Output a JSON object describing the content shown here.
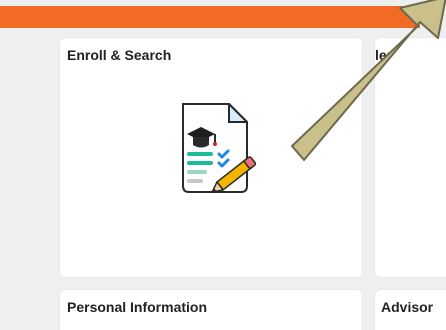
{
  "header": {
    "accent_color": "#f26a23"
  },
  "tiles": {
    "enroll": {
      "title": "Enroll & Search",
      "icon": "enroll-document-icon"
    },
    "partial_top": {
      "title": "ler"
    },
    "personal": {
      "title": "Personal Information"
    },
    "advisor": {
      "title": "Advisor"
    }
  },
  "annotation": {
    "arrow_color": "#c9c08a",
    "arrow_stroke": "#6b6a50",
    "arrow_icon": "pointer-arrow-icon"
  }
}
